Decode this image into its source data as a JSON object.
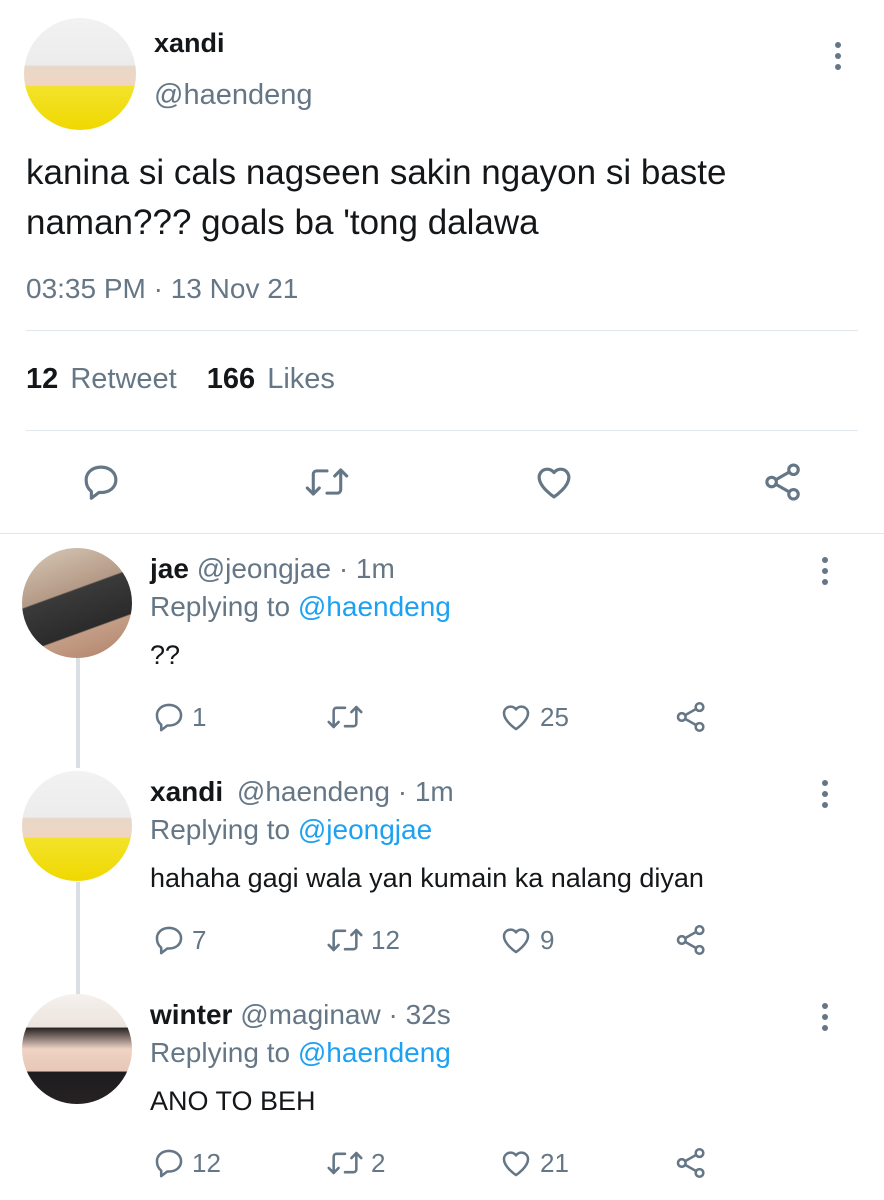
{
  "main_tweet": {
    "display_name": "xandi",
    "handle": "@haendeng",
    "text_line1": "kanina si cals nagseen sakin ngayon si baste",
    "text_line2": "naman??? goals ba 'tong dalawa",
    "timestamp": "03:35 PM · 13 Nov 21",
    "retweet_count": "12",
    "retweet_label": "Retweet",
    "like_count": "166",
    "like_label": "Likes"
  },
  "replies": [
    {
      "display_name": "jae",
      "handle": "@jeongjae",
      "time": "· 1m",
      "replying_prefix": "Replying to",
      "replying_to": "@haendeng",
      "text": "??",
      "reply_count": "1",
      "retweet_count": "",
      "like_count": "25"
    },
    {
      "display_name": "xandi",
      "handle": "@haendeng",
      "time": "· 1m",
      "replying_prefix": "Replying to",
      "replying_to": "@jeongjae",
      "text": "hahaha gagi wala yan kumain ka nalang diyan",
      "reply_count": "7",
      "retweet_count": "12",
      "like_count": "9"
    },
    {
      "display_name": "winter",
      "handle": "@maginaw",
      "time": "· 32s",
      "replying_prefix": "Replying to",
      "replying_to": "@haendeng",
      "text": "ANO TO BEH",
      "reply_count": "12",
      "retweet_count": "2",
      "like_count": "21"
    }
  ],
  "icons": {
    "reply": "speech-bubble-icon",
    "retweet": "retweet-arrows-icon",
    "like": "heart-icon",
    "share": "share-nodes-icon",
    "menu": "vertical-dots-icon"
  },
  "colors": {
    "text": "#14171a",
    "muted": "#657786",
    "link": "#1da1f2",
    "divider": "#e1e8ed"
  }
}
